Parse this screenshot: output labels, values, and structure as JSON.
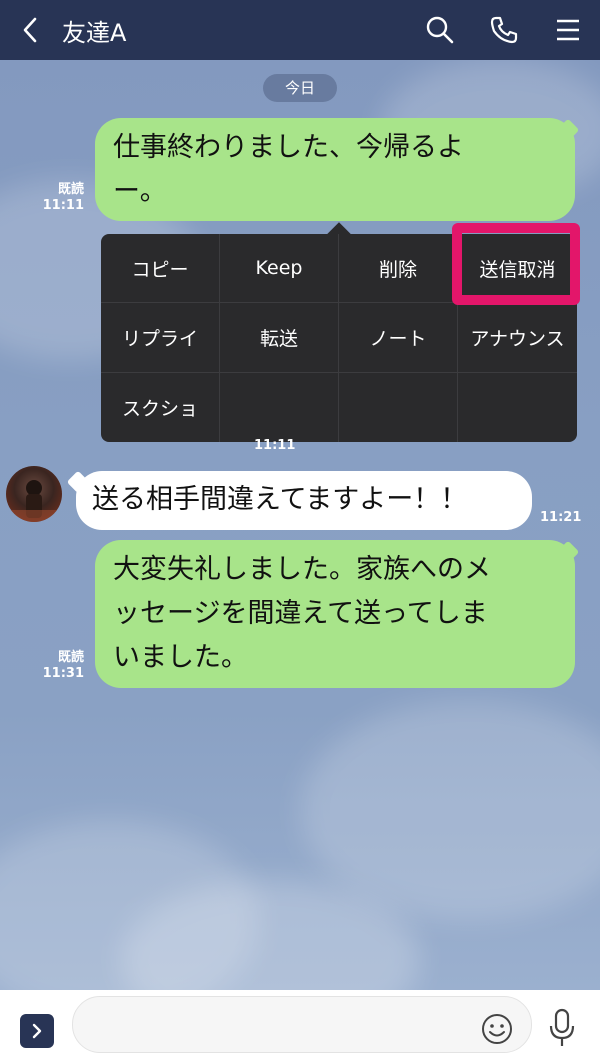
{
  "header": {
    "title": "友達A",
    "back_icon": "chevron-left-icon",
    "search_icon": "search-icon",
    "call_icon": "phone-icon",
    "menu_icon": "hamburger-menu-icon",
    "bg_color": "#283455"
  },
  "chat": {
    "date_label": "今日",
    "messages": [
      {
        "side": "me",
        "text_line1": "仕事終わりました、今帰るよ",
        "text_line2": "ー。",
        "read": "既読",
        "time": "11:11"
      },
      {
        "side": "other",
        "text": "送る相手間違えてますよー！！",
        "time": "11:21"
      },
      {
        "side": "me",
        "text_line1": "大変失礼しました。家族へのメ",
        "text_line2": "ッセージを間違えて送ってしま",
        "text_line3": "いました。",
        "read": "既読",
        "time": "11:31"
      }
    ],
    "hidden_time": "11:11"
  },
  "context_menu": {
    "items": [
      "コピー",
      "Keep",
      "削除",
      "送信取消",
      "リプライ",
      "転送",
      "ノート",
      "アナウンス",
      "スクショ"
    ],
    "highlighted": "送信取消",
    "highlight_color": "#e3166a"
  },
  "input_bar": {
    "placeholder": "",
    "expand_icon": "chevron-right-icon",
    "emoji_icon": "smiley-icon",
    "mic_icon": "microphone-icon"
  },
  "colors": {
    "my_bubble": "#a8e48a",
    "other_bubble": "#ffffff",
    "menu_bg": "#2a2a2c"
  }
}
